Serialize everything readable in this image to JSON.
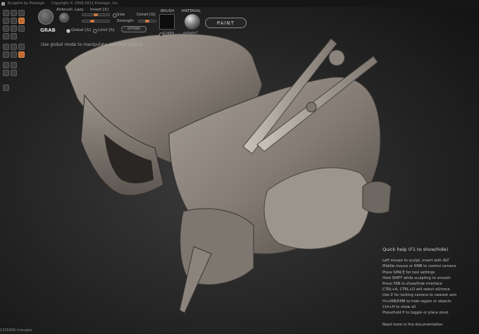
{
  "app": {
    "title": "Sculptris by Pixologic",
    "copyright": "Copyright © 2009-2011 Pixologic, Inc."
  },
  "toolbar": {
    "tool_name": "GRAB",
    "airbrush_label": "Airbrush",
    "lazy_label": "Lazy",
    "invert_label": "Invert [X]",
    "size_label": "Size",
    "strength_label": "Strength",
    "detail_label": "Detail [Q]",
    "global_label": "Global [G]",
    "limit_label": "Limit [S]",
    "options_label": "OPTIONS",
    "brush_header": "BRUSH",
    "brush_enable_label": "Enable",
    "material_header": "MATERIAL",
    "material_name": "mshade7",
    "paint_label": "PAINT",
    "size_value": 0.5,
    "strength_value": 0.35
  },
  "hint": "Use global mode to manipulate selected objects",
  "quick_help": {
    "title": "Quick help (F1 to show/hide)",
    "lines": [
      "Left mouse to sculpt, invert with ALT",
      "Middle mouse or RMB to control camera",
      "Press SPACE for tool settings",
      "Hold SHIFT while sculpting to smooth",
      "Press TAB to show/hide interface",
      "CTRL+A, CTRL+D will select all/none",
      "Use Z for locking camera to nearest axis",
      "H+LMB/RMB to hide region or objects",
      "Ctrl+H to show all",
      "Press/hold P to toggle or place pivot"
    ],
    "more": "Read more in the documentation"
  },
  "status": {
    "triangles": "1205896 triangles"
  },
  "colors": {
    "accent": "#d17a3e",
    "model": "#8f8880",
    "background": "#2a2a2a"
  }
}
